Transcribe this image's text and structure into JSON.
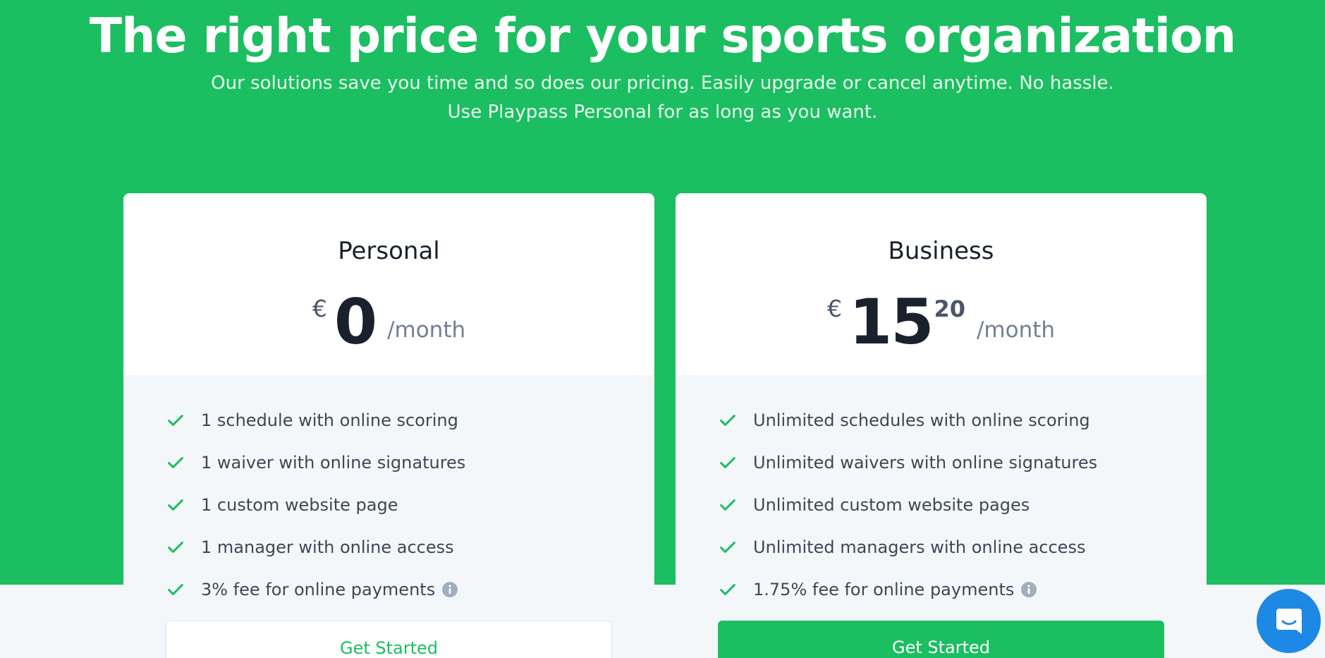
{
  "hero": {
    "title": "The right price for your sports organization",
    "subtitle_line1": "Our solutions save you time and so does our pricing. Easily upgrade or cancel anytime. No hassle.",
    "subtitle_line2": "Use Playpass Personal for as long as you want."
  },
  "plans": [
    {
      "name": "Personal",
      "currency": "€",
      "amount": "0",
      "cents": "",
      "period": "/month",
      "features": [
        "1 schedule with online scoring",
        "1 waiver with online signatures",
        "1 custom website page",
        "1 manager with online access",
        "3% fee for online payments"
      ],
      "button": "Get Started"
    },
    {
      "name": "Business",
      "currency": "€",
      "amount": "15",
      "cents": "20",
      "period": "/month",
      "features": [
        "Unlimited schedules with online scoring",
        "Unlimited waivers with online signatures",
        "Unlimited custom website pages",
        "Unlimited managers with online access",
        "1.75% fee for online payments"
      ],
      "button": "Get Started"
    }
  ],
  "icons": {
    "check": "check-icon",
    "info": "info-icon",
    "chat": "chat-icon"
  },
  "colors": {
    "brand_green": "#1bbe61",
    "chat_blue": "#1e88e5"
  }
}
